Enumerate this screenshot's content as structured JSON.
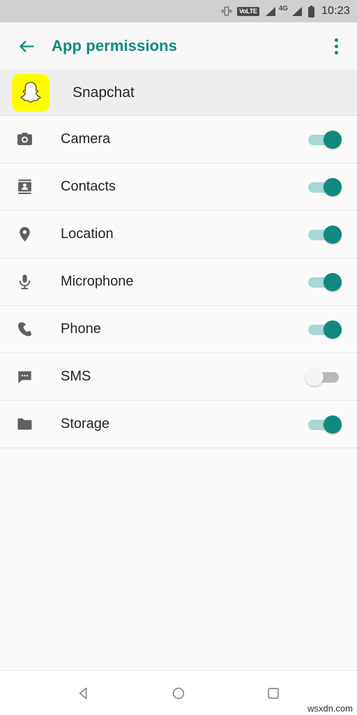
{
  "statusbar": {
    "vibrate_icon": "vibrate-icon",
    "volte_label": "VoLTE",
    "signal_icon": "signal-bars-icon",
    "network_label": "4G",
    "signal2_icon": "signal-bars-icon",
    "battery_icon": "battery-full-icon",
    "time": "10:23"
  },
  "toolbar": {
    "back_icon": "back-arrow-icon",
    "title": "App permissions",
    "overflow_icon": "overflow-menu-icon",
    "accent_color": "#10897d"
  },
  "app": {
    "name": "Snapchat",
    "icon": "snapchat-ghost-icon",
    "icon_background": "#fffc00"
  },
  "permissions": [
    {
      "label": "Camera",
      "icon": "camera-icon",
      "enabled": true,
      "state": "on"
    },
    {
      "label": "Contacts",
      "icon": "contacts-icon",
      "enabled": true,
      "state": "on"
    },
    {
      "label": "Location",
      "icon": "location-pin-icon",
      "enabled": true,
      "state": "on"
    },
    {
      "label": "Microphone",
      "icon": "microphone-icon",
      "enabled": true,
      "state": "on"
    },
    {
      "label": "Phone",
      "icon": "phone-icon",
      "enabled": true,
      "state": "on"
    },
    {
      "label": "SMS",
      "icon": "sms-icon",
      "enabled": false,
      "state": "off"
    },
    {
      "label": "Storage",
      "icon": "folder-icon",
      "enabled": true,
      "state": "on"
    }
  ],
  "navbar": {
    "back_icon": "nav-back-triangle-icon",
    "home_icon": "nav-home-circle-icon",
    "recents_icon": "nav-recents-square-icon"
  },
  "watermark": "wsxdn.com"
}
